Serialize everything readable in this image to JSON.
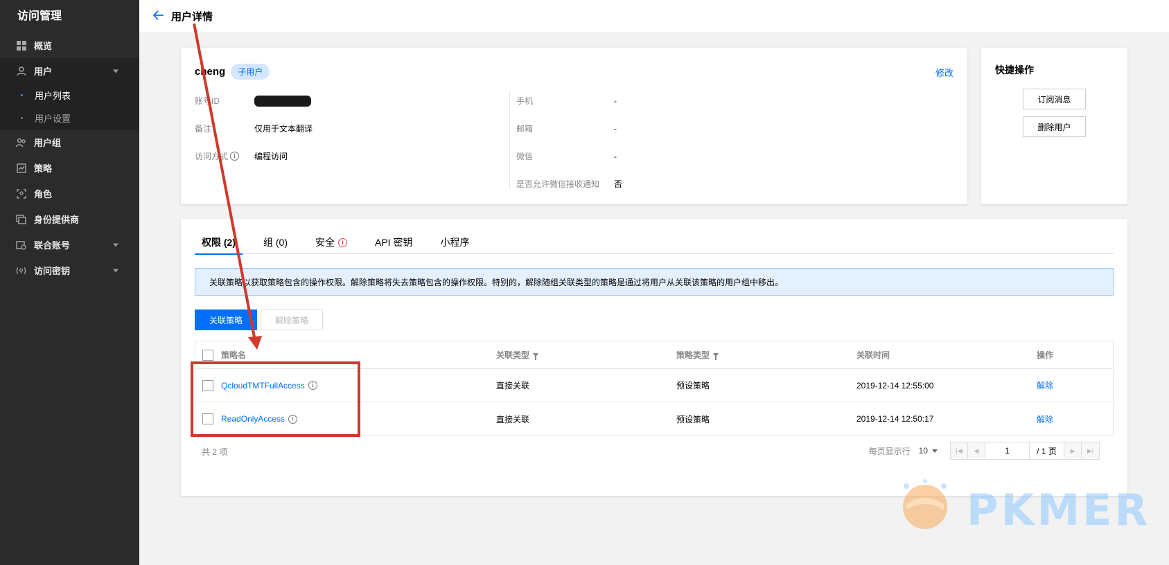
{
  "sidebar": {
    "brand": "访问管理",
    "items": [
      {
        "label": "概览",
        "icon": "grid-icon"
      },
      {
        "label": "用户",
        "icon": "user-icon"
      },
      {
        "label": "用户组",
        "icon": "users-icon"
      },
      {
        "label": "策略",
        "icon": "policy-icon"
      },
      {
        "label": "角色",
        "icon": "role-icon"
      },
      {
        "label": "身份提供商",
        "icon": "identity-provider-icon"
      },
      {
        "label": "联合账号",
        "icon": "federated-account-icon"
      },
      {
        "label": "访问密钥",
        "icon": "key-icon"
      }
    ],
    "subitems": [
      "用户列表",
      "用户设置"
    ]
  },
  "header": {
    "title": "用户详情"
  },
  "user": {
    "name": "cheng",
    "tag": "子用户",
    "edit": "修改",
    "left": [
      {
        "label": "账号ID",
        "value": ""
      },
      {
        "label": "备注",
        "value": "仅用于文本翻译"
      },
      {
        "label": "访问方式",
        "value": "编程访问"
      }
    ],
    "right": [
      {
        "label": "手机",
        "value": "-"
      },
      {
        "label": "邮箱",
        "value": "-"
      },
      {
        "label": "微信",
        "value": "-"
      },
      {
        "label": "是否允许微信接收通知",
        "value": "否"
      }
    ]
  },
  "quick": {
    "title": "快捷操作",
    "subscribe": "订阅消息",
    "delete": "删除用户"
  },
  "tabs": [
    "权限 (2)",
    "组 (0)",
    "安全",
    "API 密钥",
    "小程序"
  ],
  "notice": "关联策略以获取策略包含的操作权限。解除策略将失去策略包含的操作权限。特别的，解除随组关联类型的策略是通过将用户从关联该策略的用户组中移出。",
  "actions": {
    "attach": "关联策略",
    "detach": "解除策略"
  },
  "table": {
    "headers": [
      "策略名",
      "关联类型",
      "策略类型",
      "关联时间",
      "操作"
    ],
    "rows": [
      {
        "name": "QcloudTMTFullAccess",
        "assoc": "直接关联",
        "type": "预设策略",
        "time": "2019-12-14 12:55:00",
        "op": "解除"
      },
      {
        "name": "ReadOnlyAccess",
        "assoc": "直接关联",
        "type": "预设策略",
        "time": "2019-12-14 12:50:17",
        "op": "解除"
      }
    ]
  },
  "footer": {
    "total": "共  2  项",
    "per_page_label": "每页显示行",
    "per_page": "10",
    "page": "1",
    "page_total": "/ 1 页"
  },
  "watermark": "PKMER",
  "colors": {
    "accent": "#006eff",
    "annotation": "#d0392b",
    "sidebar": "#2b2b2b"
  }
}
